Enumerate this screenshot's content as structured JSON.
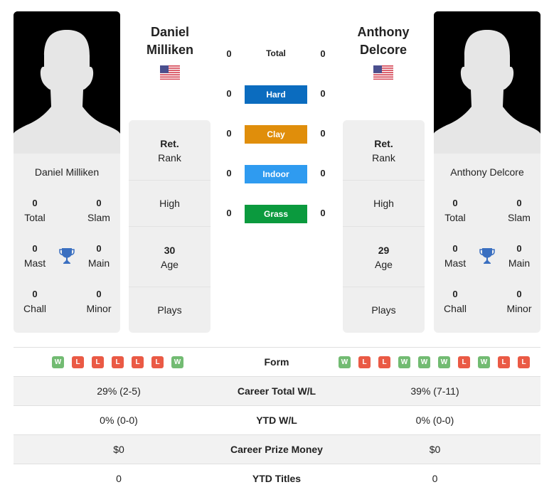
{
  "player1": {
    "name": "Daniel Milliken",
    "name_line1": "Daniel",
    "name_line2": "Milliken",
    "flag": "us-flag-icon",
    "titles": {
      "total": {
        "value": "0",
        "label": "Total"
      },
      "slam": {
        "value": "0",
        "label": "Slam"
      },
      "mast": {
        "value": "0",
        "label": "Mast"
      },
      "main": {
        "value": "0",
        "label": "Main"
      },
      "chall": {
        "value": "0",
        "label": "Chall"
      },
      "minor": {
        "value": "0",
        "label": "Minor"
      }
    },
    "rank": {
      "value": "Ret.",
      "label": "Rank"
    },
    "high": {
      "value": "",
      "label": "High"
    },
    "age": {
      "value": "30",
      "label": "Age"
    },
    "plays": {
      "value": "",
      "label": "Plays"
    },
    "form": [
      "W",
      "L",
      "L",
      "L",
      "L",
      "L",
      "W"
    ],
    "career_total_wl": "29% (2-5)",
    "ytd_wl": "0% (0-0)",
    "career_prize_money": "$0",
    "ytd_titles": "0"
  },
  "player2": {
    "name": "Anthony Delcore",
    "name_line1": "Anthony",
    "name_line2": "Delcore",
    "flag": "us-flag-icon",
    "titles": {
      "total": {
        "value": "0",
        "label": "Total"
      },
      "slam": {
        "value": "0",
        "label": "Slam"
      },
      "mast": {
        "value": "0",
        "label": "Mast"
      },
      "main": {
        "value": "0",
        "label": "Main"
      },
      "chall": {
        "value": "0",
        "label": "Chall"
      },
      "minor": {
        "value": "0",
        "label": "Minor"
      }
    },
    "rank": {
      "value": "Ret.",
      "label": "Rank"
    },
    "high": {
      "value": "",
      "label": "High"
    },
    "age": {
      "value": "29",
      "label": "Age"
    },
    "plays": {
      "value": "",
      "label": "Plays"
    },
    "form": [
      "W",
      "L",
      "L",
      "W",
      "W",
      "W",
      "L",
      "W",
      "L",
      "L"
    ],
    "career_total_wl": "39% (7-11)",
    "ytd_wl": "0% (0-0)",
    "career_prize_money": "$0",
    "ytd_titles": "0"
  },
  "h2h": {
    "total": {
      "label": "Total",
      "p1": "0",
      "p2": "0"
    },
    "surfaces": [
      {
        "label": "Hard",
        "p1": "0",
        "p2": "0",
        "color": "#0b6cbf"
      },
      {
        "label": "Clay",
        "p1": "0",
        "p2": "0",
        "color": "#e08e0b"
      },
      {
        "label": "Indoor",
        "p1": "0",
        "p2": "0",
        "color": "#2f9bf0"
      },
      {
        "label": "Grass",
        "p1": "0",
        "p2": "0",
        "color": "#0b9a3e"
      }
    ]
  },
  "table_labels": {
    "form": "Form",
    "career_total_wl": "Career Total W/L",
    "ytd_wl": "YTD W/L",
    "career_prize_money": "Career Prize Money",
    "ytd_titles": "YTD Titles"
  },
  "colors": {
    "win": "#72bb72",
    "loss": "#ea5a45",
    "trophy": "#3a6fc0"
  }
}
